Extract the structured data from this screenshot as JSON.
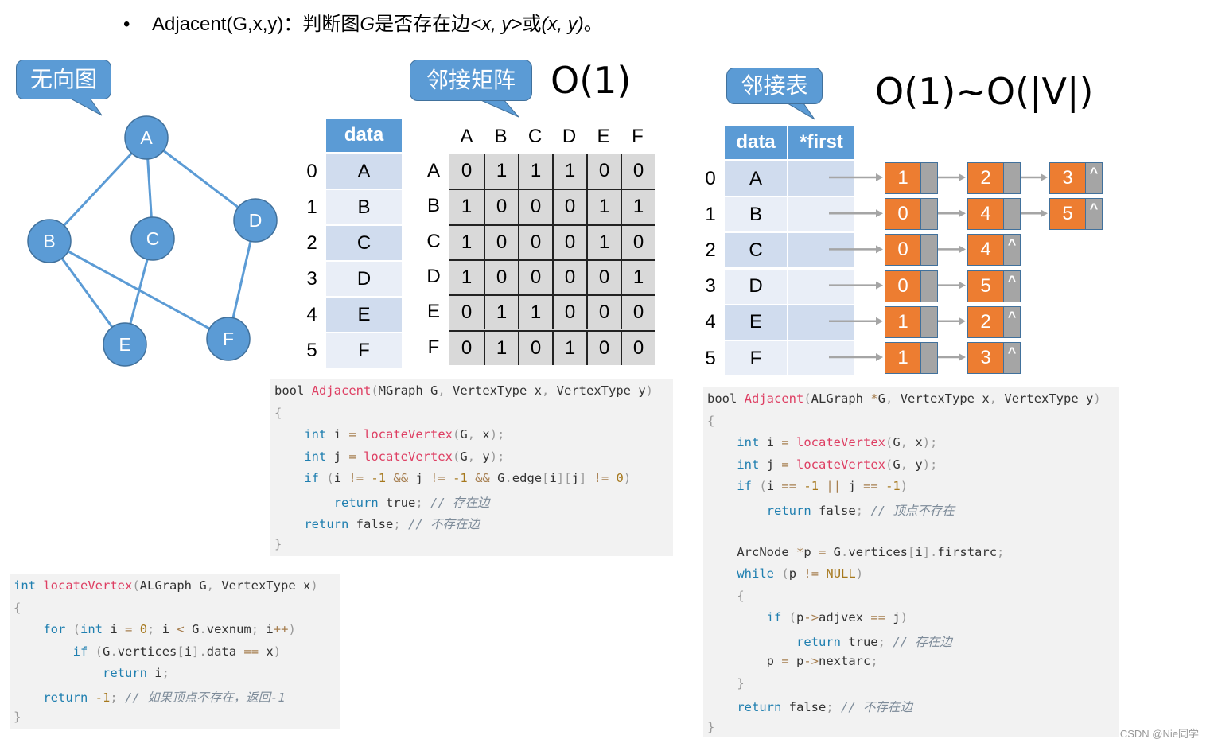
{
  "header": {
    "bullet": "•",
    "text_prefix": "Adjacent(G,x,y)：判断图",
    "text_g": "G",
    "text_mid": "是否存在边",
    "text_edge1": "<x, y>",
    "text_or": "或",
    "text_edge2": "(x, y)",
    "text_end": "。"
  },
  "callouts": {
    "undirected": "无向图",
    "matrix": "邻接矩阵",
    "list": "邻接表"
  },
  "complexity": {
    "matrix": "O(1)",
    "list": "O(1)~O(|V|)"
  },
  "graph": {
    "nodes": [
      {
        "id": "A"
      },
      {
        "id": "B"
      },
      {
        "id": "C"
      },
      {
        "id": "D"
      },
      {
        "id": "E"
      },
      {
        "id": "F"
      }
    ],
    "edges": [
      [
        "A",
        "B"
      ],
      [
        "A",
        "C"
      ],
      [
        "A",
        "D"
      ],
      [
        "B",
        "E"
      ],
      [
        "B",
        "F"
      ],
      [
        "C",
        "E"
      ],
      [
        "D",
        "F"
      ]
    ],
    "node_color": "#5b9bd5",
    "edge_color": "#5b9bd5"
  },
  "matrix_view": {
    "header": "data",
    "indices": [
      "0",
      "1",
      "2",
      "3",
      "4",
      "5"
    ],
    "vertices": [
      "A",
      "B",
      "C",
      "D",
      "E",
      "F"
    ],
    "col_labels": [
      "A",
      "B",
      "C",
      "D",
      "E",
      "F"
    ],
    "row_labels": [
      "A",
      "B",
      "C",
      "D",
      "E",
      "F"
    ],
    "matrix": [
      [
        "0",
        "1",
        "1",
        "1",
        "0",
        "0"
      ],
      [
        "1",
        "0",
        "0",
        "0",
        "1",
        "1"
      ],
      [
        "1",
        "0",
        "0",
        "0",
        "1",
        "0"
      ],
      [
        "1",
        "0",
        "0",
        "0",
        "0",
        "1"
      ],
      [
        "0",
        "1",
        "1",
        "0",
        "0",
        "0"
      ],
      [
        "0",
        "1",
        "0",
        "1",
        "0",
        "0"
      ]
    ]
  },
  "list_view": {
    "header_data": "data",
    "header_first": "*first",
    "indices": [
      "0",
      "1",
      "2",
      "3",
      "4",
      "5"
    ],
    "vertices": [
      "A",
      "B",
      "C",
      "D",
      "E",
      "F"
    ],
    "null_symbol": "^",
    "lists": [
      [
        "1",
        "2",
        "3"
      ],
      [
        "0",
        "4",
        "5"
      ],
      [
        "0",
        "4"
      ],
      [
        "0",
        "5"
      ],
      [
        "1",
        "2"
      ],
      [
        "1",
        "3"
      ]
    ],
    "node_value_color": "#ed7d31",
    "node_pointer_color": "#a5a5a5"
  },
  "code_matrix": {
    "lines": [
      "bool Adjacent(MGraph G, VertexType x, VertexType y)",
      "{",
      "    int i = locateVertex(G, x);",
      "    int j = locateVertex(G, y);",
      "    if (i != -1 && j != -1 && G.edge[i][j] != 0)",
      "        return true; // 存在边",
      "    return false; // 不存在边",
      "}"
    ]
  },
  "code_list": {
    "lines": [
      "bool Adjacent(ALGraph *G, VertexType x, VertexType y)",
      "{",
      "    int i = locateVertex(G, x);",
      "    int j = locateVertex(G, y);",
      "    if (i == -1 || j == -1)",
      "        return false; // 顶点不存在",
      "",
      "    ArcNode *p = G.vertices[i].firstarc;",
      "    while (p != NULL)",
      "    {",
      "        if (p->adjvex == j)",
      "            return true; // 存在边",
      "        p = p->nextarc;",
      "    }",
      "    return false; // 不存在边",
      "}"
    ]
  },
  "code_locate": {
    "lines": [
      "int locateVertex(ALGraph G, VertexType x)",
      "{",
      "    for (int i = 0; i < G.vexnum; i++)",
      "        if (G.vertices[i].data == x)",
      "            return i;",
      "    return -1; // 如果顶点不存在，返回-1",
      "}"
    ]
  },
  "watermark": "CSDN @Nie同学"
}
